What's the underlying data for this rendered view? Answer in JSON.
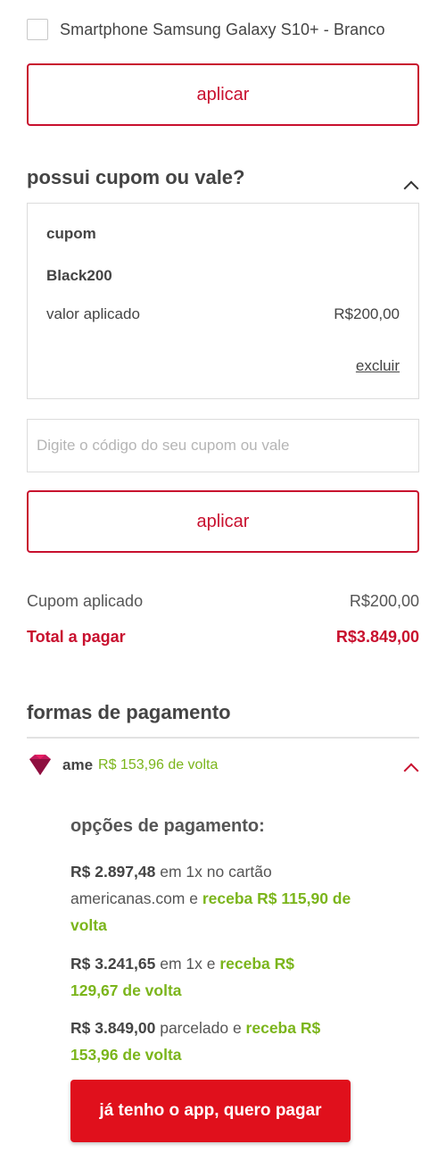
{
  "product": {
    "name": "Smartphone Samsung Galaxy S10+ - Branco",
    "checked": false
  },
  "apply_button_top": {
    "label": "aplicar"
  },
  "coupon_section": {
    "title": "possui cupom ou vale?",
    "applied": {
      "label": "cupom",
      "code": "Black200",
      "value_label": "valor aplicado",
      "value": "R$200,00",
      "remove_link": "excluir"
    },
    "input_placeholder": "Digite o código do seu cupom ou vale",
    "input_value": "",
    "apply_label": "aplicar"
  },
  "summary": {
    "coupon_label": "Cupom aplicado",
    "coupon_value": "R$200,00",
    "total_label": "Total a pagar",
    "total_value": "R$3.849,00"
  },
  "payment": {
    "title": "formas de pagamento",
    "ame": {
      "icon": "ame-diamond-icon",
      "name": "ame",
      "cashback": "R$ 153,96 de volta",
      "options_title": "opções de pagamento:",
      "options": [
        {
          "amount": "R$ 2.897,48",
          "text": " em 1x no cartão americanas.com e ",
          "cashback": "receba R$ 115,90 de volta"
        },
        {
          "amount": "R$ 3.241,65",
          "text": " em 1x e ",
          "cashback": "receba R$ 129,67 de volta"
        },
        {
          "amount": "R$ 3.849,00",
          "text": " parcelado e ",
          "cashback": "receba R$ 153,96 de volta"
        }
      ],
      "cta": "já tenho o app, quero pagar"
    }
  },
  "colors": {
    "brand_red": "#c8102e",
    "cta_red": "#e0101c",
    "cashback_green": "#7bb51b",
    "ame_pink": "#c2185b"
  }
}
